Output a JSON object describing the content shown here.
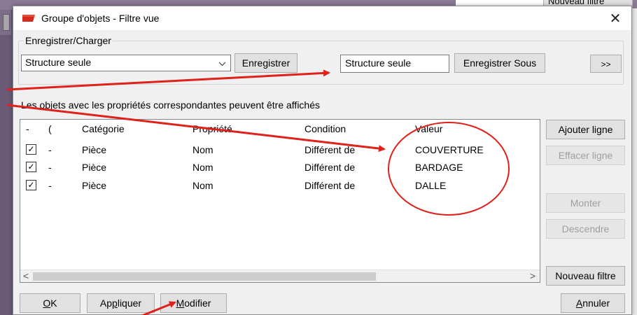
{
  "background": {
    "top_button": "Nouveau filtre"
  },
  "window": {
    "title": "Groupe d'objets - Filtre vue",
    "close_glyph": "✕"
  },
  "save_load": {
    "group_label": "Enregistrer/Charger",
    "combo_value": "Structure seule",
    "save_button": "Enregistrer",
    "name_field_value": "Structure seule",
    "save_as_button": "Enregistrer Sous",
    "expand_button": ">>"
  },
  "filter_caption": "Les objets avec les propriétés correspondantes peuvent être affichés",
  "table": {
    "headers": [
      "-",
      "(",
      "Catégorie",
      "Propriété",
      "Condition",
      "Valeur"
    ],
    "rows": [
      {
        "checked": true,
        "paren": "-",
        "category": "Pièce",
        "property": "Nom",
        "condition": "Différent de",
        "value": "COUVERTURE"
      },
      {
        "checked": true,
        "paren": "-",
        "category": "Pièce",
        "property": "Nom",
        "condition": "Différent de",
        "value": "BARDAGE"
      },
      {
        "checked": true,
        "paren": "-",
        "category": "Pièce",
        "property": "Nom",
        "condition": "Différent de",
        "value": "DALLE"
      }
    ],
    "scroll_left": "<",
    "scroll_right": ">"
  },
  "side_buttons": {
    "add_line": "Ajouter ligne",
    "delete_line": "Effacer ligne",
    "move_up": "Monter",
    "move_down": "Descendre",
    "new_filter": "Nouveau filtre"
  },
  "bottom_buttons": {
    "ok_accel": "O",
    "ok_rest": "K",
    "apply_pre": "Ap",
    "apply_accel": "p",
    "apply_post": "liquer",
    "modify_accel": "M",
    "modify_rest": "odifier",
    "cancel_accel": "A",
    "cancel_rest": "nnuler"
  },
  "colors": {
    "annotation": "#e0201a",
    "dialog_bg": "#f0f0f0",
    "button_bg": "#e1e1e1"
  },
  "icons": {
    "app": "red-flag-icon",
    "checkbox": "checkmark-icon",
    "dropdown": "chevron-down-icon"
  }
}
